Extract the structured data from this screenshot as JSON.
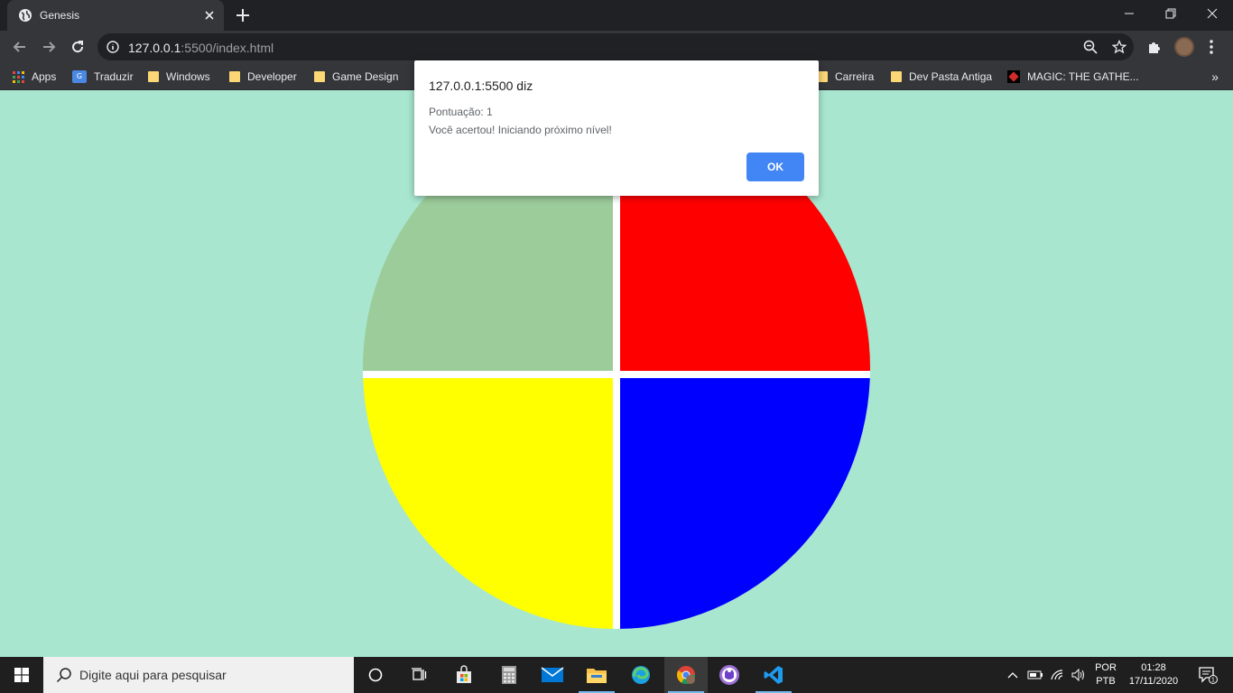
{
  "browser": {
    "tab_title": "Genesis",
    "url_host": "127.0.0.1",
    "url_path": ":5500/index.html"
  },
  "bookmarks": [
    {
      "label": "Apps",
      "icon": "apps-grid-icon"
    },
    {
      "label": "Traduzir",
      "icon": "google-translate-icon"
    },
    {
      "label": "Windows",
      "icon": "folder-icon"
    },
    {
      "label": "Developer",
      "icon": "folder-icon"
    },
    {
      "label": "Game Design",
      "icon": "folder-icon"
    },
    {
      "label": "Carreira",
      "icon": "folder-icon"
    },
    {
      "label": "Dev Pasta Antiga",
      "icon": "folder-icon"
    },
    {
      "label": "MAGIC: THE GATHE...",
      "icon": "mtg-icon"
    }
  ],
  "dialog": {
    "title": "127.0.0.1:5500 diz",
    "line1": "Pontuação: 1",
    "line2": "Você acertou! Iniciando próximo nível!",
    "ok_label": "OK"
  },
  "game": {
    "quadrants": [
      {
        "name": "green",
        "color": "#9ccc9a"
      },
      {
        "name": "red",
        "color": "#ff0000"
      },
      {
        "name": "yellow",
        "color": "#ffff00"
      },
      {
        "name": "blue",
        "color": "#0000ff"
      }
    ],
    "background": "#a8e6cf"
  },
  "taskbar": {
    "search_placeholder": "Digite aqui para pesquisar",
    "lang_line1": "POR",
    "lang_line2": "PTB",
    "time": "01:28",
    "date": "17/11/2020",
    "notification_count": "1"
  }
}
